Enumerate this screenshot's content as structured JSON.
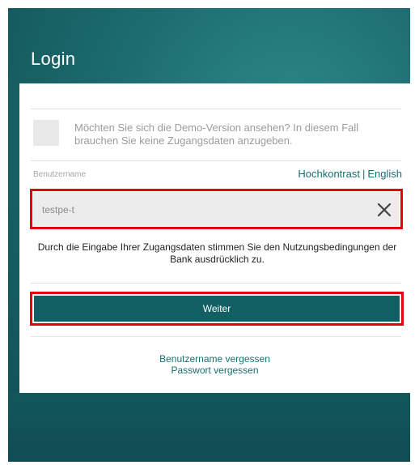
{
  "header": {
    "title": "Login"
  },
  "demo": {
    "text": "Möchten Sie sich die Demo-Version ansehen? In diesem Fall brauchen Sie keine Zugangsdaten anzugeben.",
    "checked": false
  },
  "username": {
    "label": "Benutzername",
    "value": "testpe-t",
    "clear_icon": "close-icon"
  },
  "links": {
    "high_contrast": "Hochkontrast",
    "separator": "|",
    "english": "English"
  },
  "consent": {
    "text": "Durch die Eingabe Ihrer Zugangsdaten stimmen Sie den Nutzungsbedingungen der Bank ausdrücklich zu."
  },
  "actions": {
    "continue_label": "Weiter",
    "forgot_username": "Benutzername vergessen",
    "forgot_password": "Passwort vergessen"
  },
  "colors": {
    "accent": "#115e63",
    "highlight": "#e3000f",
    "background": "#1c6c6f"
  }
}
